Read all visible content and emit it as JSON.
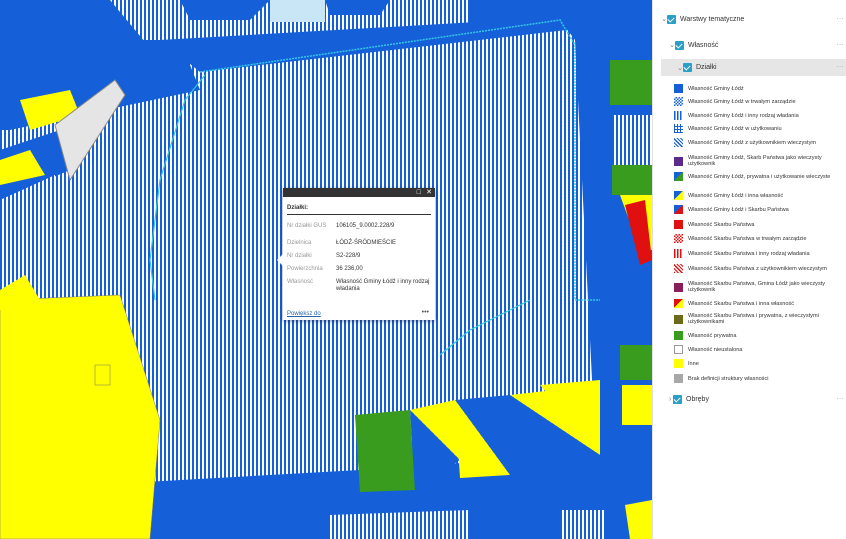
{
  "layers": {
    "root": {
      "label": "Warstwy tematyczne"
    },
    "group": {
      "label": "Własność"
    },
    "sublayer": {
      "label": "Działki"
    },
    "obreby": {
      "label": "Obręby"
    },
    "more": "..."
  },
  "legend": [
    {
      "label": "Własność Gminy Łódź",
      "swatch": "solid-blue"
    },
    {
      "label": "Własność Gminy Łódź w trwałym zarządzie",
      "swatch": "blue-checker"
    },
    {
      "label": "Własność Gminy Łódź i inny rodzaj władania",
      "swatch": "blue-vertical-stripes"
    },
    {
      "label": "Własność Gminy Łódź w użytkowaniu",
      "swatch": "blue-grid"
    },
    {
      "label": "Własność Gminy Łódź z użytkownikiem wieczystym",
      "swatch": "blue-diagonal-stripes"
    },
    {
      "label": "Własność Gminy Łódź, Skarb Państwa jako wieczysty użytkownik",
      "swatch": "solid-purple"
    },
    {
      "label": "Własność Gminy Łódź, prywatna i użytkowanie wieczyste",
      "swatch": "blue-green-triangle"
    },
    {
      "label": "Własność Gminy Łódź i inna własność",
      "swatch": "blue-yellow-triangle"
    },
    {
      "label": "Własność Gminy Łódź i Skarbu Państwa",
      "swatch": "blue-red-triangle"
    },
    {
      "label": "Własność Skarbu Państwa",
      "swatch": "solid-red"
    },
    {
      "label": "Własność Skarbu Państwa w trwałym zarządzie",
      "swatch": "red-checker"
    },
    {
      "label": "Własność Skarbu Państwa i inny rodzaj władania",
      "swatch": "red-vertical-stripes"
    },
    {
      "label": "Własność Skarbu Państwa z użytkownikiem wieczystym",
      "swatch": "red-diagonal-stripes"
    },
    {
      "label": "Własność Skarbu Państwa, Gmina Łódź jako wieczysty użytkownik",
      "swatch": "solid-dark-magenta"
    },
    {
      "label": "Własność Skarbu Państwa i inna własność",
      "swatch": "red-yellow-triangle"
    },
    {
      "label": "Własność Skarbu Państwa i prywatna, z wieczystymi użytkownikami",
      "swatch": "solid-olive"
    },
    {
      "label": "Własność prywatna",
      "swatch": "solid-green"
    },
    {
      "label": "Własność nieustalona",
      "swatch": "white"
    },
    {
      "label": "Inne",
      "swatch": "solid-yellow"
    },
    {
      "label": "Brak definicji struktury własności",
      "swatch": "solid-gray"
    }
  ],
  "popup": {
    "title": "Działki:",
    "fields": [
      {
        "label": "Nr działki GUS",
        "value": "106105_9.0002.228/9"
      },
      {
        "label": "Dzielnica",
        "value": "ŁÓDŹ-ŚRÓDMIEŚCIE"
      },
      {
        "label": "Nr działki",
        "value": "S2-228/9"
      },
      {
        "label": "Powierzchnia",
        "value": "36 236,00"
      },
      {
        "label": "Własność",
        "value": "Własność Gminy Łódź i inny rodzaj władania"
      }
    ],
    "zoom_link": "Powiększ do",
    "more": "•••",
    "maximize_icon": "□",
    "close_icon": "✕"
  },
  "colors": {
    "blue": "#1560d8",
    "yellow": "#ffff00",
    "green": "#3a9c1e",
    "red": "#e01010",
    "light_blue": "#c9e6f7",
    "checkbox": "#2aa0c8"
  }
}
